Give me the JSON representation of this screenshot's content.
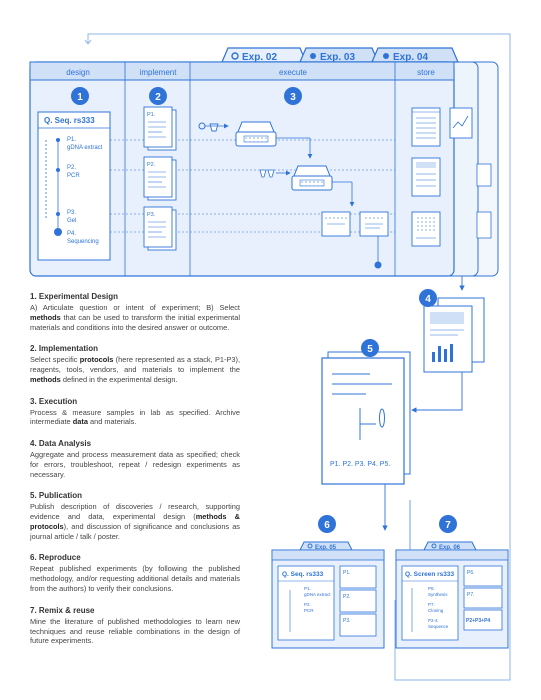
{
  "colors": {
    "accent": "#2f73d8",
    "panel_fill": "#e7f0fc",
    "header_band": "#cfe0f7",
    "line": "#2f73d8",
    "text_dark": "#333333"
  },
  "tabs": [
    {
      "label": "Exp. 02",
      "icon": "open-circle-icon"
    },
    {
      "label": "Exp. 03",
      "icon": "filled-circle-icon"
    },
    {
      "label": "Exp. 04",
      "icon": "filled-circle-icon"
    }
  ],
  "phases": [
    "design",
    "implement",
    "execute",
    "store"
  ],
  "badges": [
    "1",
    "2",
    "3",
    "4",
    "5",
    "6",
    "7"
  ],
  "design_card": {
    "title": "Q. Seq. rs333",
    "items": [
      {
        "code": "P1.",
        "label": "gDNA extract"
      },
      {
        "code": "P2.",
        "label": "PCR"
      },
      {
        "code": "P3.",
        "label": "Gel"
      },
      {
        "code": "P4.",
        "label": "Sequencing"
      }
    ]
  },
  "protocol_pages": [
    "P1.",
    "P2.",
    "P3."
  ],
  "publication": {
    "label": "P1. P2. P3. P4. P5."
  },
  "reproduce": {
    "tab": "Exp. 05",
    "title": "Q. Seq. rs333",
    "items": [
      "P1.",
      "gDNA extract",
      "P2.",
      "PCR"
    ],
    "side": [
      "P1.",
      "P2.",
      "P3."
    ]
  },
  "remix": {
    "tab": "Exp. 06",
    "title": "Q. Screen rs333",
    "items": [
      "P6.",
      "Synthesis",
      "P7.",
      "Cloning",
      "P2-4.",
      "Sequence"
    ],
    "side": [
      "P6.",
      "P7.",
      "P2+P3+P4"
    ]
  },
  "steps": [
    {
      "title": "1. Experimental Design",
      "p1": "A) Articulate question or intent of experiment; B) Select ",
      "b1": "methods",
      "p2": " that can be used to transform the initial experimental materials and conditions into the desired answer or outcome.",
      "b2": "",
      "p3": "",
      "b3": "",
      "p4": ""
    },
    {
      "title": "2. Implementation",
      "p1": "Select specific ",
      "b1": "protocols",
      "p2": " (here represented as a stack, P1-P3), reagents, tools, vendors, and materials to implement the ",
      "b2": "methods",
      "p3": " defined in the experimental design.",
      "b3": "",
      "p4": ""
    },
    {
      "title": "3. Execution",
      "p1": "Process & measure samples in lab as specified. Archive intermediate ",
      "b1": "data",
      "p2": " and materials.",
      "b2": "",
      "p3": "",
      "b3": "",
      "p4": ""
    },
    {
      "title": "4. Data Analysis",
      "p1": "Aggregate and process measurement data as specified; check for errors, troubleshoot, repeat / redesign experiments as necessary.",
      "b1": "",
      "p2": "",
      "b2": "",
      "p3": "",
      "b3": "",
      "p4": ""
    },
    {
      "title": "5. Publication",
      "p1": "Publish description of discoveries / research, supporting evidence and data, experimental design (",
      "b1": "methods & protocols",
      "p2": "), and discussion of significance and conclusions as journal article / talk / poster.",
      "b2": "",
      "p3": "",
      "b3": "",
      "p4": ""
    },
    {
      "title": "6. Reproduce",
      "p1": "Repeat published experiments (by following the published methodology, and/or requesting additional details and materials from the authors) to verify their conclusions.",
      "b1": "",
      "p2": "",
      "b2": "",
      "p3": "",
      "b3": "",
      "p4": ""
    },
    {
      "title": "7. Remix & reuse",
      "p1": "Mine the literature of published methodologies to learn new techniques and reuse reliable combinations in the design of future experiments.",
      "b1": "",
      "p2": "",
      "b2": "",
      "p3": "",
      "b3": "",
      "p4": ""
    }
  ]
}
